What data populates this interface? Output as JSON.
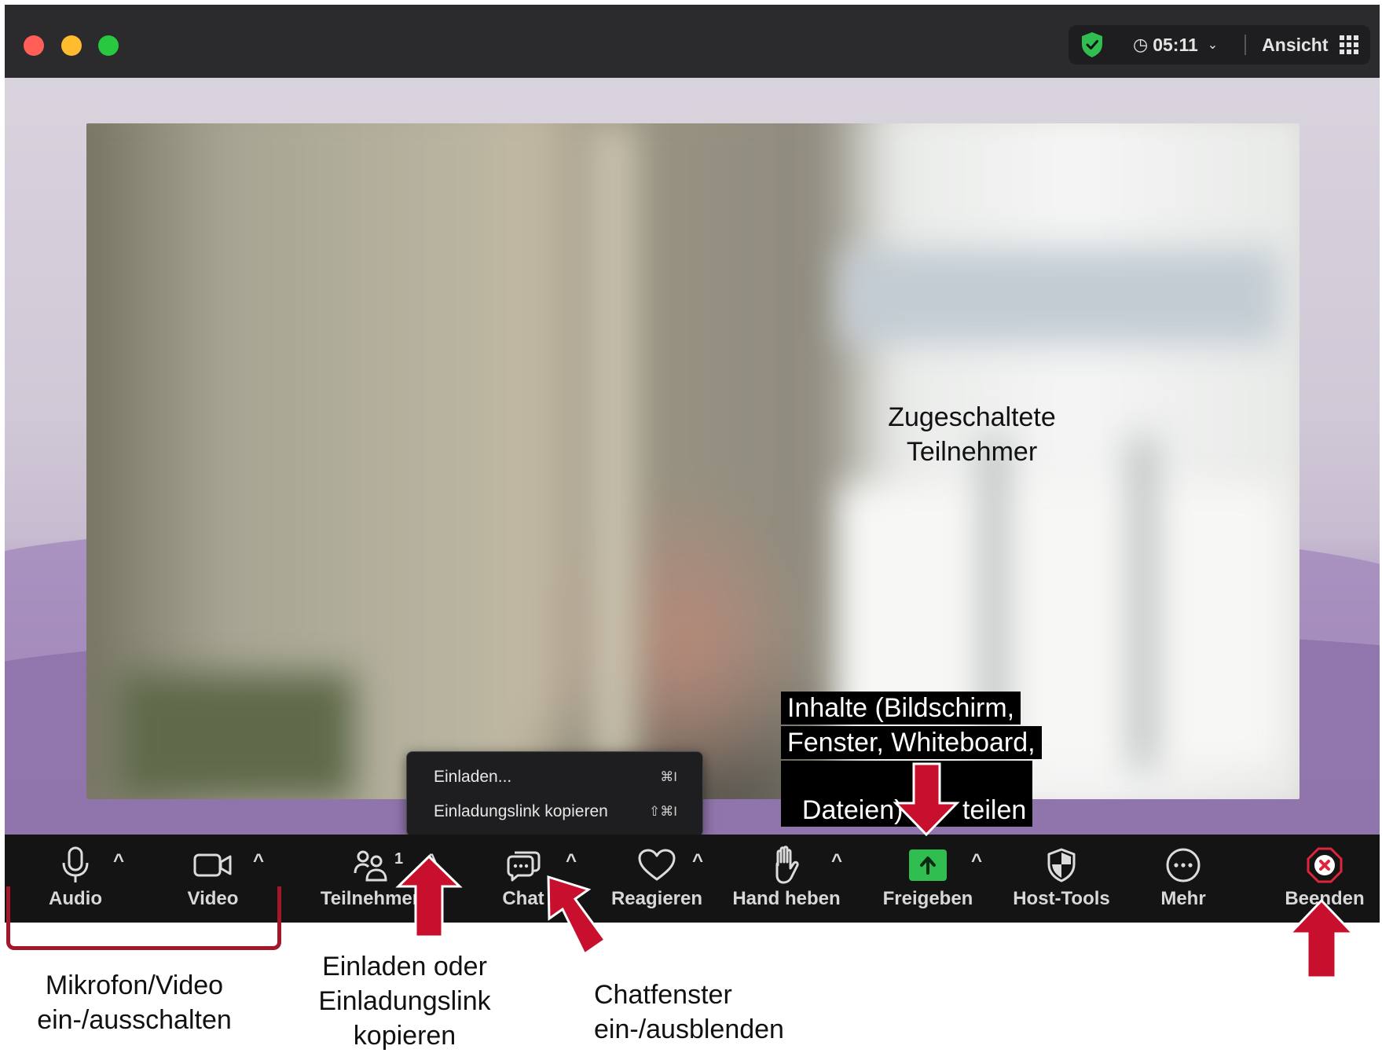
{
  "header": {
    "timer": "05:11",
    "view_label": "Ansicht",
    "security_icon": "green-shield-check-icon"
  },
  "stage": {
    "overlay_label": "Zugeschaltete Teilnehmer"
  },
  "invite_menu": {
    "items": [
      {
        "label": "Einladen...",
        "shortcut": "⌘I"
      },
      {
        "label": "Einladungslink kopieren",
        "shortcut": "⇧⌘I"
      }
    ]
  },
  "toolbar": {
    "audio": "Audio",
    "video": "Video",
    "participants": "Teilnehmer",
    "participants_count": "1",
    "chat": "Chat",
    "react": "Reagieren",
    "raise_hand": "Hand heben",
    "share": "Freigeben",
    "host_tools": "Host-Tools",
    "more": "Mehr",
    "end": "Beenden",
    "caret": "^",
    "share_color": "#2fbe4f",
    "end_color": "#e0243b"
  },
  "annotations": {
    "share_callout_line1": "Inhalte (Bildschirm,",
    "share_callout_line2": "Fenster, Whiteboard,",
    "share_callout_line3": "Dateien)        teilen",
    "mic_video_line1": "Mikrofon/Video",
    "mic_video_line2": "ein-/ausschalten",
    "invite_line1": "Einladen oder",
    "invite_line2": "Einladungslink",
    "invite_line3": "kopieren",
    "chat_line1": "Chatfenster",
    "chat_line2": "ein-/ausblenden",
    "arrow_color": "#c8102e"
  }
}
